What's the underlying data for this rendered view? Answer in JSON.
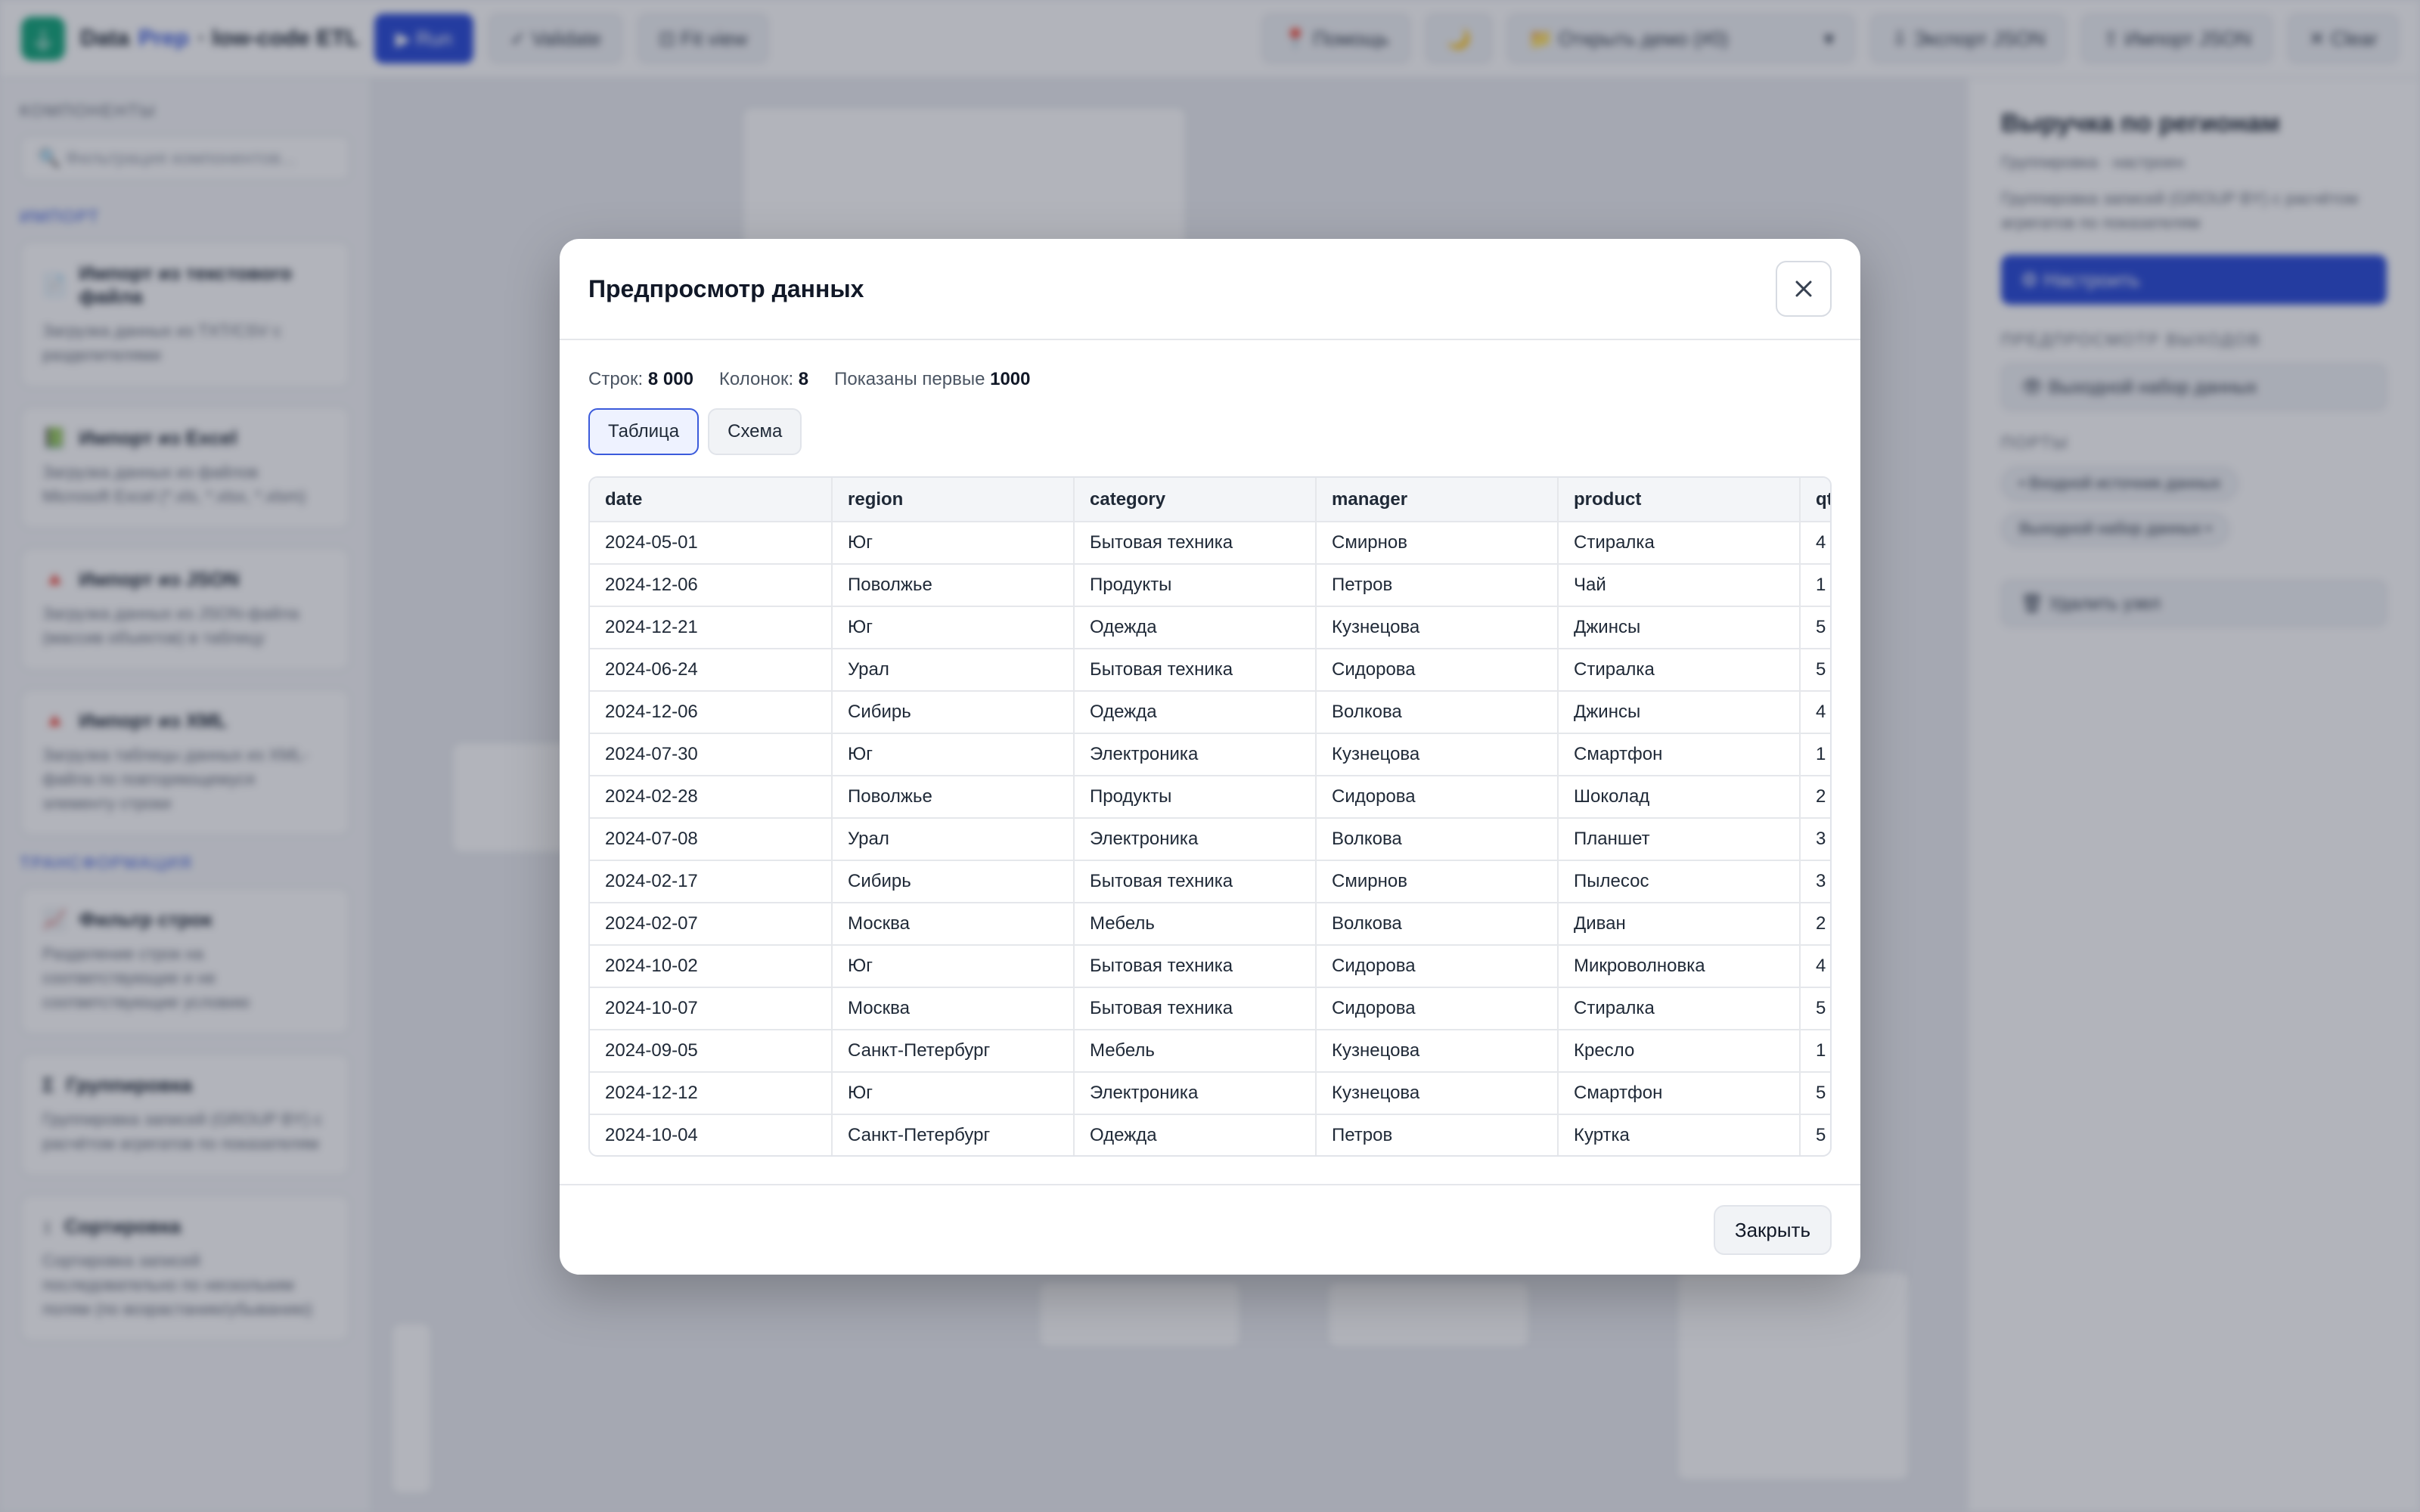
{
  "topbar": {
    "brand_a": "Data",
    "brand_b": "Prep",
    "brand_c": "· low-code ETL",
    "run": "▶ Run",
    "validate": "✓ Validate",
    "fit": "⊡ Fit view",
    "help": "📍 Помощь",
    "theme": "🌙",
    "demo": "📁 Открыть демо (#0)",
    "export": "⇩ Экспорт JSON",
    "import": "⇧ Импорт JSON",
    "clear": "✕ Clear"
  },
  "sidebar": {
    "heading": "КОМПОНЕНТЫ",
    "search_placeholder": "🔍 Фильтрация компонентов...",
    "group_import": "ИМПОРТ",
    "group_transform": "ТРАНСФОРМАЦИЯ",
    "cards": [
      {
        "icon": "📄",
        "title": "Импорт из текстового файла",
        "desc": "Загрузка данных из TXT/CSV с разделителями"
      },
      {
        "icon": "📗",
        "title": "Импорт из Excel",
        "desc": "Загрузка данных из файлов Microsoft Excel (*.xls, *.xlsx, *.xlsm)"
      },
      {
        "icon": "🔺",
        "title": "Импорт из JSON",
        "desc": "Загрузка данных из JSON-файла (массив объектов) в таблицу"
      },
      {
        "icon": "🔺",
        "title": "Импорт из XML",
        "desc": "Загрузка таблицы данных из XML-файла по повторяющемуся элементу строки"
      },
      {
        "icon": "📈",
        "title": "Фильтр строк",
        "desc": "Разделение строк на соответствующие и не соответствующие условию"
      },
      {
        "icon": "Σ",
        "title": "Группировка",
        "desc": "Группировка записей (GROUP BY) с расчётом агрегатов по показателям"
      },
      {
        "icon": "↕",
        "title": "Сортировка",
        "desc": "Сортировка записей последовательно по нескольким полям (по возрастанию/убыванию)"
      }
    ]
  },
  "right": {
    "title": "Выручка по регионам",
    "subtitle": "Группировка · настроен",
    "desc": "Группировка записей (GROUP BY) с расчётом агрегатов по показателям",
    "configure": "⚙ Настроить",
    "preview_head": "ПРЕДПРОСМОТР ВЫХОДОВ",
    "output_btn": "👁 Выходной набор данных",
    "ports_head": "ПОРТЫ",
    "port_in": "• Входной источник данных",
    "port_out": "Выходной набор данных •",
    "delete": "🗑 Удалить узел"
  },
  "modal": {
    "title": "Предпросмотр данных",
    "rows_label": "Строк:",
    "rows_value": "8 000",
    "cols_label": "Колонок:",
    "cols_value": "8",
    "shown_label": "Показаны первые",
    "shown_value": "1000",
    "tab_table": "Таблица",
    "tab_schema": "Схема",
    "close": "Закрыть",
    "columns": [
      "date",
      "region",
      "category",
      "manager",
      "product",
      "qty"
    ],
    "rows": [
      [
        "2024-05-01",
        "Юг",
        "Бытовая техника",
        "Смирнов",
        "Стиралка",
        "4"
      ],
      [
        "2024-12-06",
        "Поволжье",
        "Продукты",
        "Петров",
        "Чай",
        "1"
      ],
      [
        "2024-12-21",
        "Юг",
        "Одежда",
        "Кузнецова",
        "Джинсы",
        "5"
      ],
      [
        "2024-06-24",
        "Урал",
        "Бытовая техника",
        "Сидорова",
        "Стиралка",
        "5"
      ],
      [
        "2024-12-06",
        "Сибирь",
        "Одежда",
        "Волкова",
        "Джинсы",
        "4"
      ],
      [
        "2024-07-30",
        "Юг",
        "Электроника",
        "Кузнецова",
        "Смартфон",
        "1"
      ],
      [
        "2024-02-28",
        "Поволжье",
        "Продукты",
        "Сидорова",
        "Шоколад",
        "2"
      ],
      [
        "2024-07-08",
        "Урал",
        "Электроника",
        "Волкова",
        "Планшет",
        "3"
      ],
      [
        "2024-02-17",
        "Сибирь",
        "Бытовая техника",
        "Смирнов",
        "Пылесос",
        "3"
      ],
      [
        "2024-02-07",
        "Москва",
        "Мебель",
        "Волкова",
        "Диван",
        "2"
      ],
      [
        "2024-10-02",
        "Юг",
        "Бытовая техника",
        "Сидорова",
        "Микроволновка",
        "4"
      ],
      [
        "2024-10-07",
        "Москва",
        "Бытовая техника",
        "Сидорова",
        "Стиралка",
        "5"
      ],
      [
        "2024-09-05",
        "Санкт-Петербург",
        "Мебель",
        "Кузнецова",
        "Кресло",
        "1"
      ],
      [
        "2024-12-12",
        "Юг",
        "Электроника",
        "Кузнецова",
        "Смартфон",
        "5"
      ],
      [
        "2024-10-04",
        "Санкт-Петербург",
        "Одежда",
        "Петров",
        "Куртка",
        "5"
      ]
    ]
  }
}
